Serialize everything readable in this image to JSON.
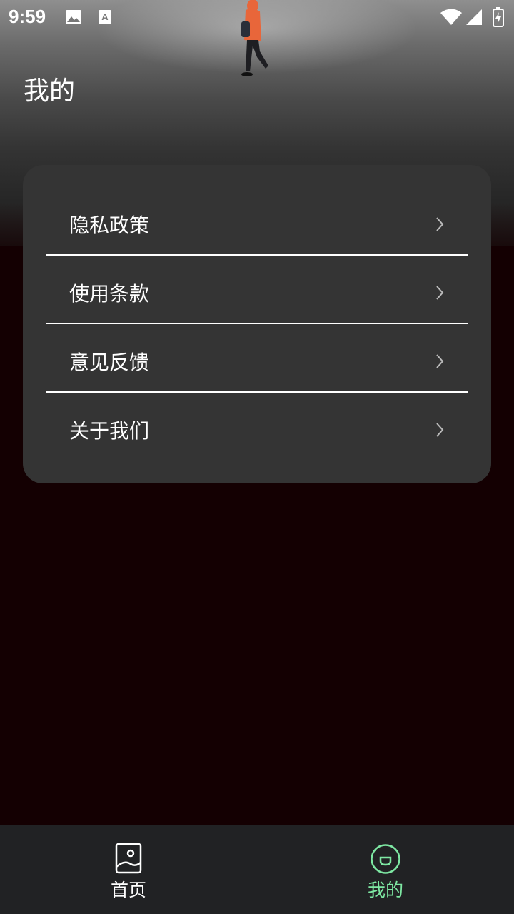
{
  "status_bar": {
    "time": "9:59",
    "icons": [
      "image-icon",
      "font-icon",
      "wifi-icon",
      "signal-icon",
      "battery-charging-icon"
    ]
  },
  "header": {
    "title": "我的"
  },
  "menu": {
    "items": [
      {
        "label": "隐私政策",
        "icon": "chevron-right-icon"
      },
      {
        "label": "使用条款",
        "icon": "chevron-right-icon"
      },
      {
        "label": "意见反馈",
        "icon": "chevron-right-icon"
      },
      {
        "label": "关于我们",
        "icon": "chevron-right-icon"
      }
    ]
  },
  "tabbar": {
    "tabs": [
      {
        "label": "首页",
        "icon": "picture-icon",
        "active": false
      },
      {
        "label": "我的",
        "icon": "smile-face-icon",
        "active": true
      }
    ]
  },
  "colors": {
    "background": "#140002",
    "card": "#343434",
    "tabbar": "#212224",
    "active_tab": "#7ee8a3",
    "inactive_tab": "#ffffff"
  }
}
